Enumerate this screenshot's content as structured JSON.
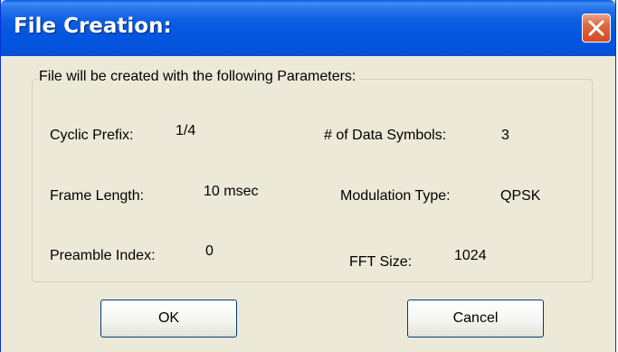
{
  "window": {
    "title": "File Creation:"
  },
  "group": {
    "legend": "File will be created with the following Parameters:"
  },
  "params": {
    "cyclic_prefix_label": "Cyclic Prefix:",
    "cyclic_prefix_value": "1/4",
    "frame_length_label": "Frame Length:",
    "frame_length_value": "10 msec",
    "preamble_index_label": "Preamble Index:",
    "preamble_index_value": "0",
    "data_symbols_label": "# of Data Symbols:",
    "data_symbols_value": "3",
    "modulation_type_label": "Modulation Type:",
    "modulation_type_value": "QPSK",
    "fft_size_label": "FFT Size:",
    "fft_size_value": "1024"
  },
  "buttons": {
    "ok_label": "OK",
    "cancel_label": "Cancel"
  },
  "colors": {
    "titlebar": "#0456e0",
    "close_button": "#d44b24",
    "dialog_background": "#ece9d8"
  }
}
